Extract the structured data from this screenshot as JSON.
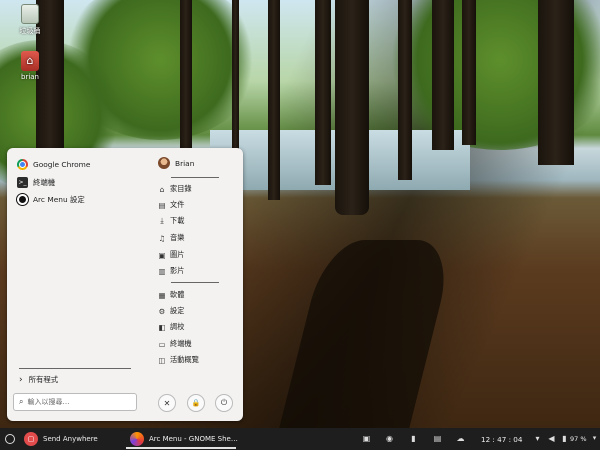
{
  "desktop": {
    "icons": [
      {
        "label": "垃圾桶",
        "icon": "trash-icon"
      },
      {
        "label": "brian",
        "icon": "home-folder-icon"
      }
    ]
  },
  "menu": {
    "favorites": [
      {
        "label": "Google Chrome",
        "icon": "chrome-icon"
      },
      {
        "label": "終端機",
        "icon": "terminal-icon"
      },
      {
        "label": "Arc Menu 設定",
        "icon": "arc-menu-icon"
      }
    ],
    "user": "Brian",
    "places": [
      {
        "label": "家目錄",
        "icon": "⌂"
      },
      {
        "label": "文件",
        "icon": "▤"
      },
      {
        "label": "下載",
        "icon": "⤓"
      },
      {
        "label": "音樂",
        "icon": "♫"
      },
      {
        "label": "圖片",
        "icon": "▣"
      },
      {
        "label": "影片",
        "icon": "▥"
      }
    ],
    "system": [
      {
        "label": "軟體",
        "icon": "▦"
      },
      {
        "label": "設定",
        "icon": "⚙"
      },
      {
        "label": "調校",
        "icon": "◧"
      },
      {
        "label": "終端機",
        "icon": "▭"
      },
      {
        "label": "活動概覽",
        "icon": "◫"
      }
    ],
    "all_apps": "所有程式",
    "search_placeholder": "輸入以搜尋…",
    "buttons": {
      "cancel": "✕",
      "lock": "🔒",
      "power": "⏻"
    }
  },
  "panel": {
    "tasks": [
      {
        "label": "Send Anywhere",
        "icon": "send-anywhere-icon"
      },
      {
        "label": "Arc Menu - GNOME She…",
        "icon": "firefox-icon"
      }
    ],
    "clock": "12 : 47 : 04",
    "battery": "97 %"
  }
}
